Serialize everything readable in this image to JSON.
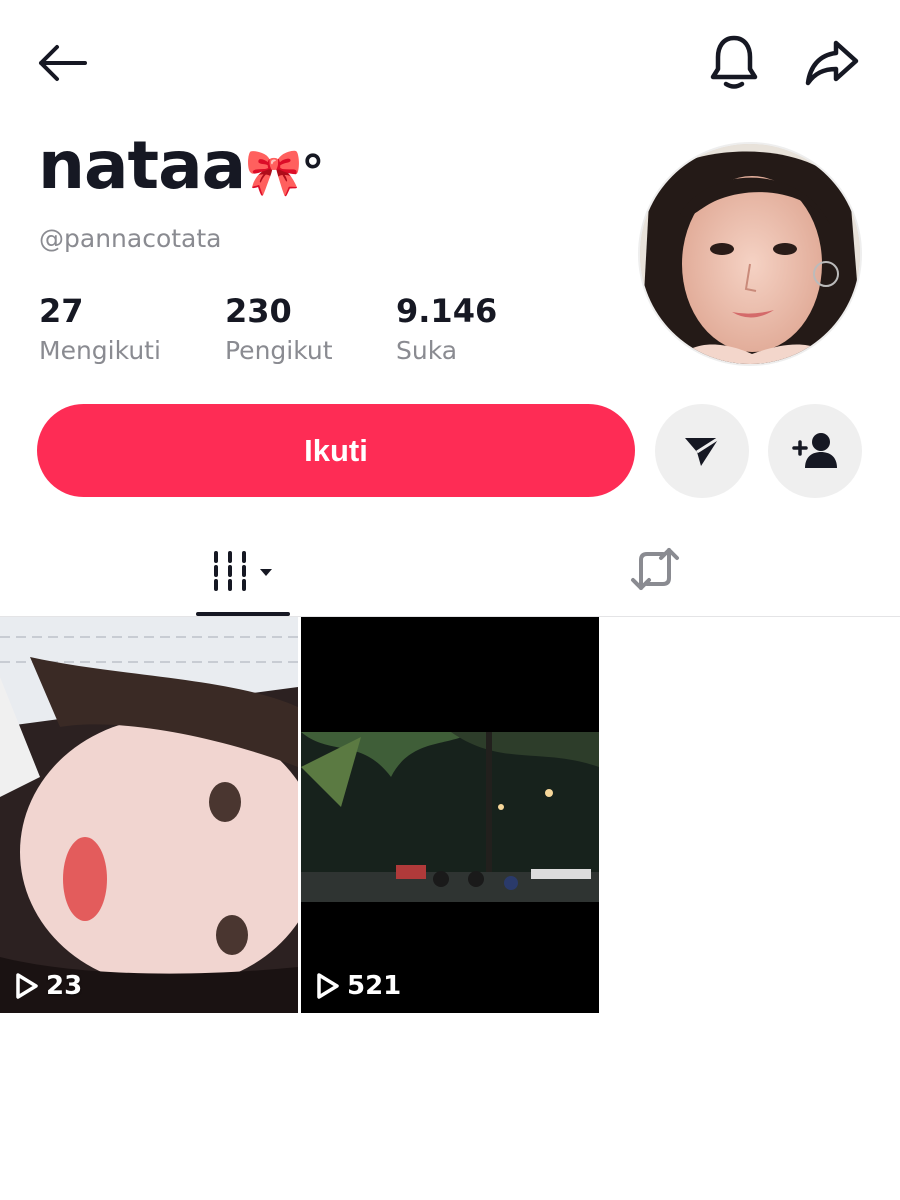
{
  "profile": {
    "display_name": "nataa",
    "display_name_emoji": "🎀°",
    "username": "@pannacotata"
  },
  "stats": [
    {
      "value": "27",
      "label": "Mengikuti"
    },
    {
      "value": "230",
      "label": "Pengikut"
    },
    {
      "value": "9.146",
      "label": "Suka"
    }
  ],
  "actions": {
    "follow_label": "Ikuti"
  },
  "icons": {
    "back": "arrow-left-icon",
    "notifications": "bell-icon",
    "share": "share-icon",
    "message": "send-icon",
    "add_friend": "add-user-icon",
    "videos_tab": "grid-icon",
    "reposts_tab": "repost-icon",
    "play": "play-icon"
  },
  "videos": [
    {
      "views": "23"
    },
    {
      "views": "521"
    }
  ],
  "colors": {
    "accent": "#fe2c55",
    "text": "#161823",
    "muted": "#8a8b91",
    "button_bg": "#efefef"
  }
}
